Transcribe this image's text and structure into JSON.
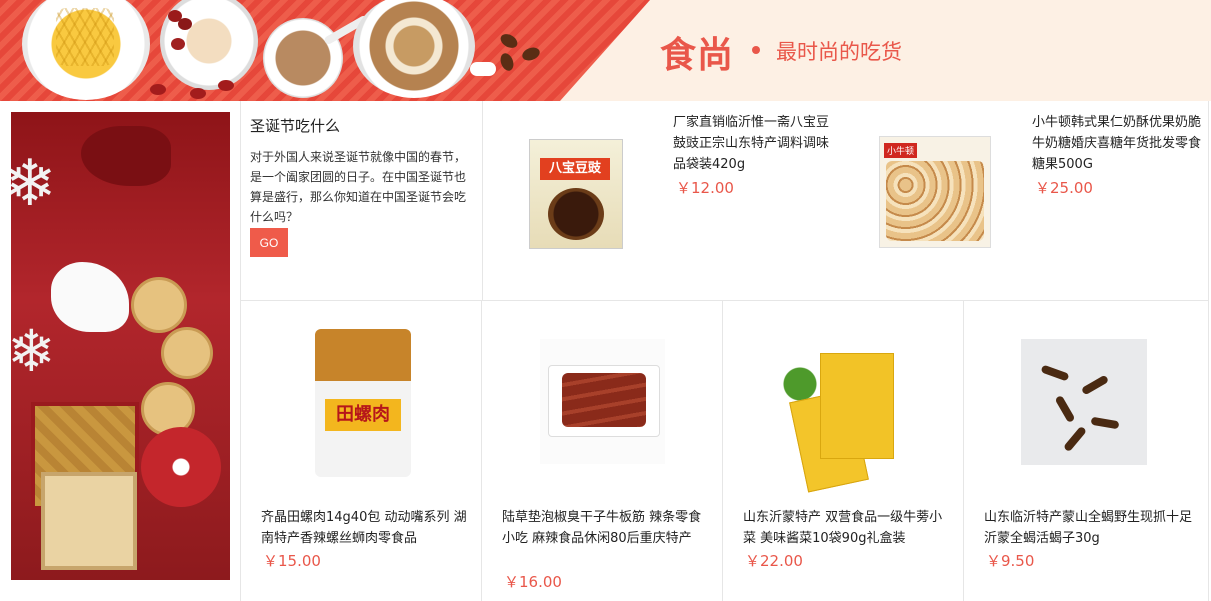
{
  "banner": {
    "brand": "食尚",
    "slogan": "最时尚的吃货"
  },
  "feature": {
    "title": "圣诞节吃什么",
    "description": "对于外国人来说圣诞节就像中国的春节，是一个阖家团圆的日子。在中国圣诞节也算是盛行，那么你知道在中国圣诞节会吃什么吗？",
    "button_label": "GO"
  },
  "top_products": [
    {
      "name": "厂家直销临沂惟一斋八宝豆鼓豉正宗山东特产调料调味品袋装420g",
      "price": "￥12.00",
      "pack_label": "八宝豆豉"
    },
    {
      "name": "小牛顿韩式果仁奶酥优果奶脆牛奶糖婚庆喜糖年货批发零食糖果500G",
      "price": "￥25.00",
      "pack_label": "小牛顿"
    }
  ],
  "bottom_products": [
    {
      "name": "齐晶田螺肉14g40包 动动嘴系列 湖南特产香辣螺丝蛳肉零食品",
      "price": "￥15.00",
      "pack_label": "田螺肉"
    },
    {
      "name": "陆草垫泡椒臭干子牛板筋 辣条零食小吃 麻辣食品休闲80后重庆特产",
      "price": "￥16.00"
    },
    {
      "name": "山东沂蒙特产 双营食品一级牛蒡小菜 美味酱菜10袋90g礼盒装",
      "price": "￥22.00"
    },
    {
      "name": "山东临沂特产蒙山全蝎野生现抓十足沂蒙全蝎活蝎子30g",
      "price": "￥9.50"
    }
  ],
  "colors": {
    "accent": "#e9574a",
    "button": "#ef5b4a",
    "banner_red": "#e6473a",
    "banner_cream": "#fdf0e4"
  }
}
